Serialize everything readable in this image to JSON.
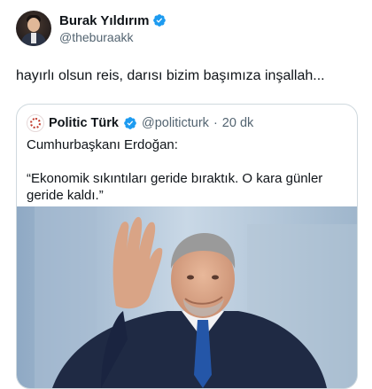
{
  "tweet": {
    "author_name": "Burak Yıldırım",
    "author_handle": "@theburaakk",
    "text": "hayırlı olsun reis, darısı bizim başımıza inşallah..."
  },
  "quoted_tweet": {
    "author_name": "Politic Türk",
    "author_handle": "@politicturk",
    "separator": "·",
    "time": "20 dk",
    "line1": "Cumhurbaşkanı Erdoğan:",
    "line2": "“Ekonomik sıkıntıları geride bıraktık. O kara günler geride kaldı.”"
  },
  "colors": {
    "verified": "#1d9bf0",
    "secondary_text": "#536471",
    "border": "#cfd9de"
  },
  "icons": {
    "verified": "verified-badge-icon"
  }
}
